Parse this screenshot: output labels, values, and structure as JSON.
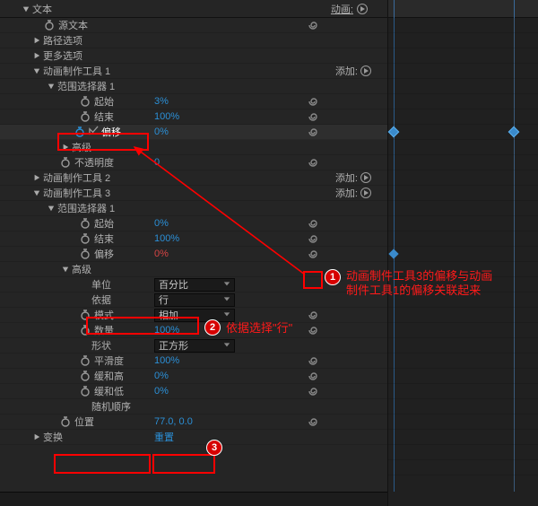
{
  "top": {
    "group_label": "文本",
    "anim_label": "动画:"
  },
  "rows": {
    "source_text": "源文本",
    "path_options": "路径选项",
    "more_options": "更多选项",
    "animator1": "动画制作工具 1",
    "animator2": "动画制作工具 2",
    "animator3": "动画制作工具 3",
    "range_selector1": "范围选择器 1",
    "start": "起始",
    "end": "结束",
    "offset": "偏移",
    "advanced": "高级",
    "opacity": "不透明度",
    "units": "单位",
    "based_on": "依据",
    "mode": "模式",
    "amount": "数量",
    "shape": "形状",
    "ease_high": "平滑度",
    "ease_low": "缓和高",
    "ease_low2": "缓和低",
    "random_order": "随机顺序",
    "position": "位置",
    "transform": "变换",
    "add_label": "添加:",
    "reset_label": "重置"
  },
  "vals": {
    "a1_start": "3%",
    "a1_end": "100%",
    "a1_offset": "0%",
    "a1_opacity": "0",
    "a3_start": "0%",
    "a3_end": "100%",
    "a3_offset": "0%",
    "units_sel": "百分比",
    "based_on_sel": "行",
    "mode_sel": "相加",
    "amount": "100%",
    "shape_sel": "正方形",
    "ease_high": "100%",
    "ease_low": "0%",
    "ease_low2": "0%",
    "position": "77.0, 0.0"
  },
  "annot": {
    "n1_line1": "动画制件工具3的偏移与动画",
    "n1_line2": "制件工具1的偏移关联起来",
    "n2": "依据选择\"行\""
  },
  "icons": {
    "stopwatch": "stopwatch-icon",
    "spiral": "expression-spiral-icon",
    "twirl_down": "twirl-down-icon",
    "twirl_right": "twirl-right-icon",
    "play": "play-icon",
    "chev": "chevron-down-icon"
  }
}
